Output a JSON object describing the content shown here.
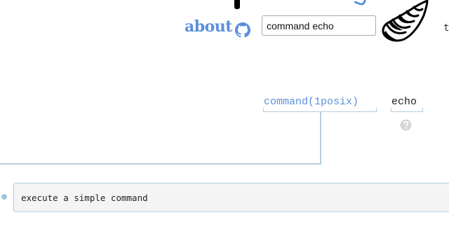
{
  "header": {
    "about_label": "about",
    "search": {
      "value": "command echo",
      "placeholder": ""
    },
    "truncated_text": "t",
    "icons": [
      "github-icon",
      "shell-icon"
    ]
  },
  "explanation": {
    "parts": [
      {
        "label": "command(1posix)",
        "type": "link"
      },
      {
        "label": "echo",
        "type": "text"
      }
    ],
    "help_icon": "question-mark-icon",
    "help_text": "execute a simple command"
  },
  "colors": {
    "accent": "#5b8fdc",
    "connector": "#b6cfe0",
    "help_box_bg": "#f4f4f4"
  }
}
